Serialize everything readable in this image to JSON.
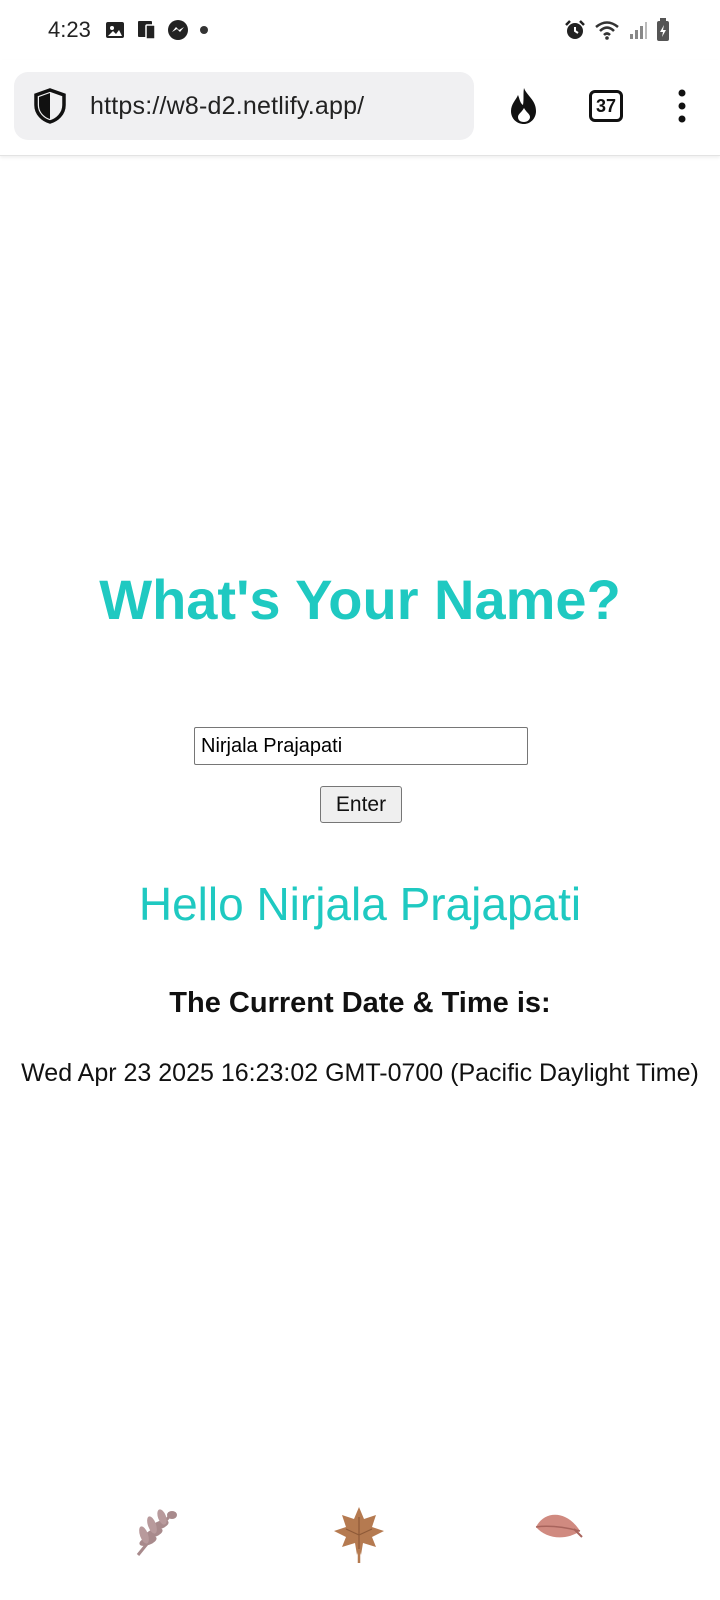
{
  "status_bar": {
    "time": "4:23",
    "icons": [
      "gallery-icon",
      "cast-icon",
      "messenger-icon",
      "dot-icon",
      "alarm-icon",
      "wifi-icon",
      "signal-icon",
      "battery-icon"
    ]
  },
  "browser": {
    "url": "https://w8-d2.netlify.app/",
    "tab_count": "37",
    "icons": [
      "shield-icon",
      "flame-icon",
      "tabs-icon",
      "more-icon"
    ]
  },
  "page": {
    "heading": "What's Your Name?",
    "name_input_value": "Nirjala Prajapati",
    "enter_label": "Enter",
    "greeting": "Hello Nirjala Prajapati",
    "datetime_heading": "The Current Date & Time is:",
    "datetime_value": "Wed Apr 23 2025 16:23:02 GMT-0700 (Pacific Daylight Time)"
  },
  "colors": {
    "accent": "#1fc9c1",
    "leaf_1": "#a88a8c",
    "leaf_2": "#b57a50",
    "leaf_3": "#d08a80"
  },
  "decorations": [
    "leaf-fern-icon",
    "leaf-maple-icon",
    "leaf-oval-icon"
  ]
}
